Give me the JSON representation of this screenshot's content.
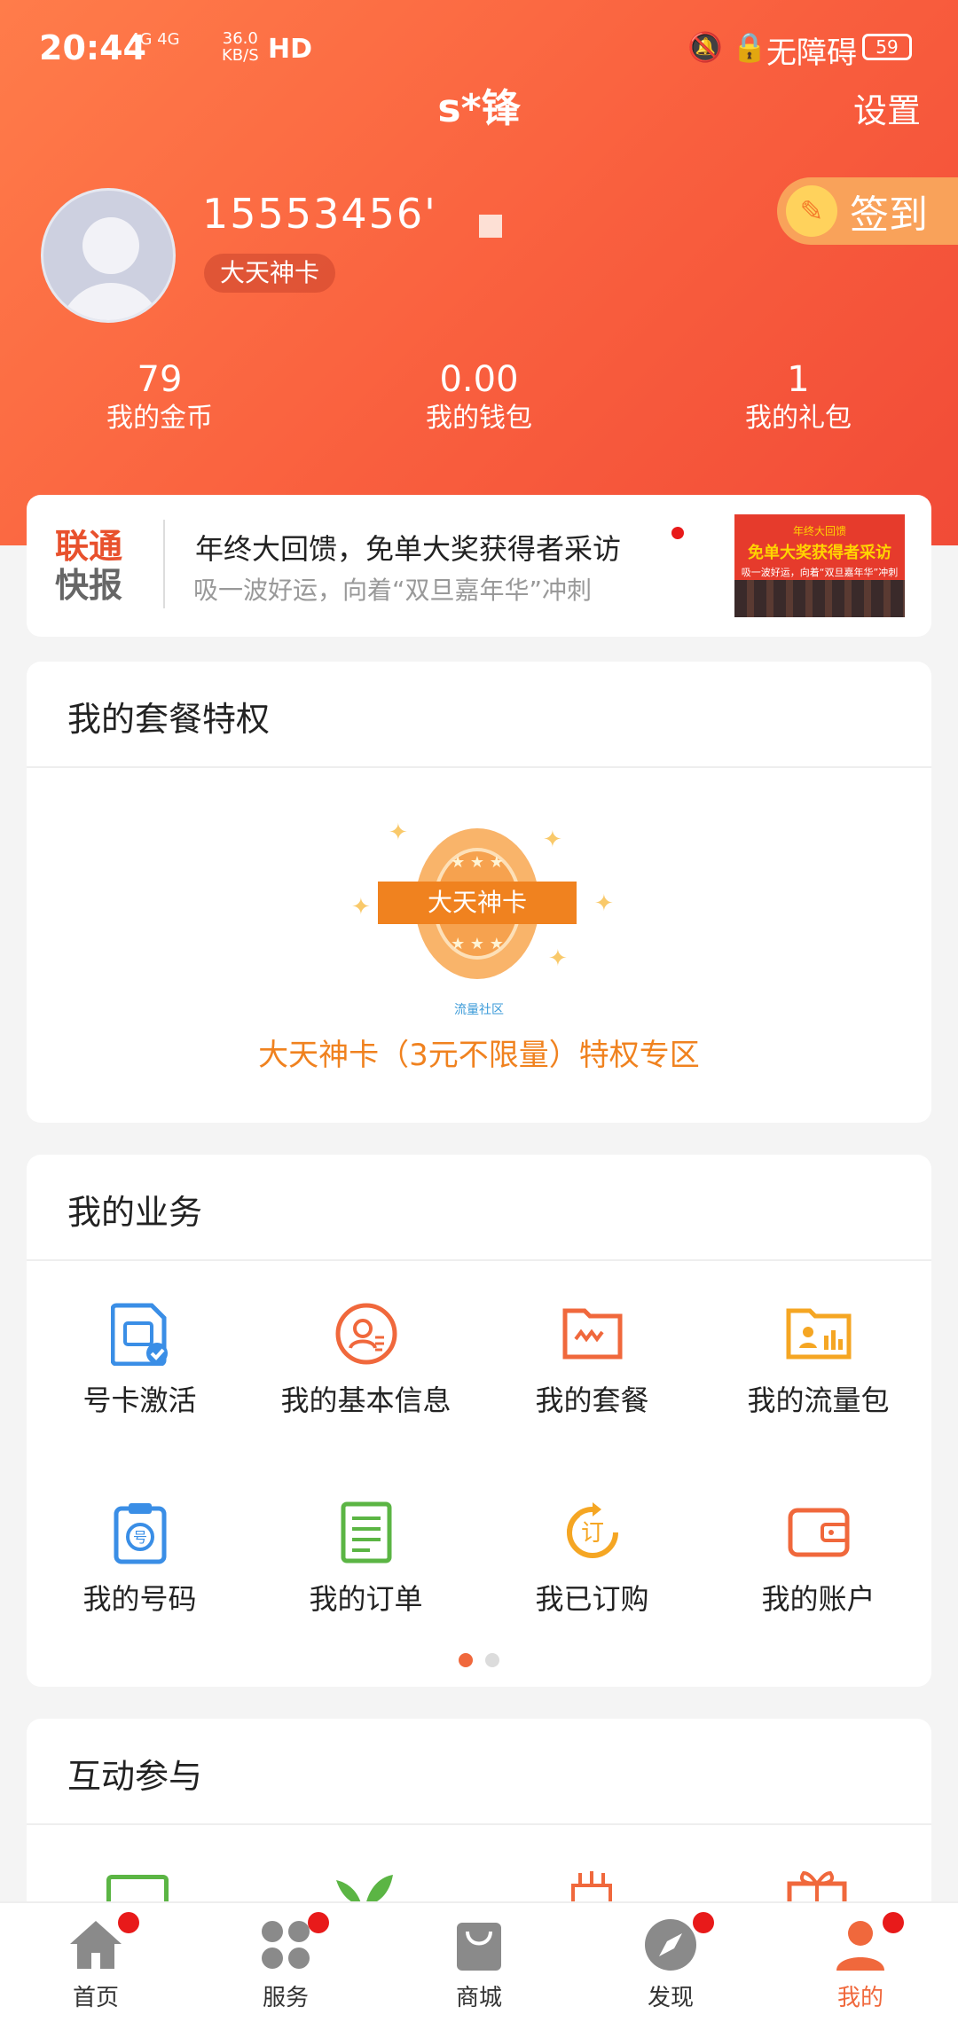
{
  "status_bar": {
    "time": "20:44",
    "network": "4G 4G",
    "speed_value": "36.0",
    "speed_unit": "KB/S",
    "hd": "HD",
    "icons": "🔕 🔒",
    "accessibility": "无障碍",
    "battery": "59"
  },
  "header": {
    "username": "s*锋",
    "settings": "设置",
    "phone": "15553456'",
    "plan": "大天神卡",
    "signin": "签到"
  },
  "stats": [
    {
      "value": "79",
      "label": "我的金币"
    },
    {
      "value": "0.00",
      "label": "我的钱包"
    },
    {
      "value": "1",
      "label": "我的礼包"
    }
  ],
  "news": {
    "logo_line1": "联通",
    "logo_line2": "快报",
    "title": "年终大回馈，免单大奖获得者采访",
    "subtitle": "吸一波好运，向着“双旦嘉年华”冲刺",
    "thumb_line1": "年终大回馈",
    "thumb_line2": "免单大奖获得者采访",
    "thumb_line3": "吸一波好运，向着“双旦嘉年华”冲刺"
  },
  "privilege": {
    "title": "我的套餐特权",
    "badge_text": "大天神卡",
    "badge_caption": "流量社区",
    "zone_text": "大天神卡（3元不限量）特权专区"
  },
  "business": {
    "title": "我的业务",
    "items": [
      {
        "label": "号卡激活",
        "icon": "sim-card-check-icon",
        "color": "#3a8ee6"
      },
      {
        "label": "我的基本信息",
        "icon": "user-info-icon",
        "color": "#f0683c"
      },
      {
        "label": "我的套餐",
        "icon": "plan-card-icon",
        "color": "#f0683c"
      },
      {
        "label": "我的流量包",
        "icon": "data-folder-icon",
        "color": "#f5a623"
      },
      {
        "label": "我的号码",
        "icon": "number-clipboard-icon",
        "color": "#3a8ee6"
      },
      {
        "label": "我的订单",
        "icon": "order-list-icon",
        "color": "#5bb544"
      },
      {
        "label": "我已订购",
        "icon": "subscribed-icon",
        "color": "#f5a623"
      },
      {
        "label": "我的账户",
        "icon": "wallet-icon",
        "color": "#f0683c"
      }
    ],
    "pager_active": "#f0683c",
    "pager_inactive": "#dcdcdc"
  },
  "interact": {
    "title": "互动参与"
  },
  "tabbar": [
    {
      "label": "首页",
      "icon": "home-icon",
      "badge": true,
      "active": false
    },
    {
      "label": "服务",
      "icon": "apps-icon",
      "badge": true,
      "active": false
    },
    {
      "label": "商城",
      "icon": "shopping-bag-icon",
      "badge": false,
      "active": false
    },
    {
      "label": "发现",
      "icon": "compass-icon",
      "badge": true,
      "active": false
    },
    {
      "label": "我的",
      "icon": "profile-icon",
      "badge": true,
      "active": true
    }
  ],
  "colors": {
    "brand": "#f95f3e",
    "accent_orange": "#f0821f",
    "inactive_tab": "#888888"
  }
}
